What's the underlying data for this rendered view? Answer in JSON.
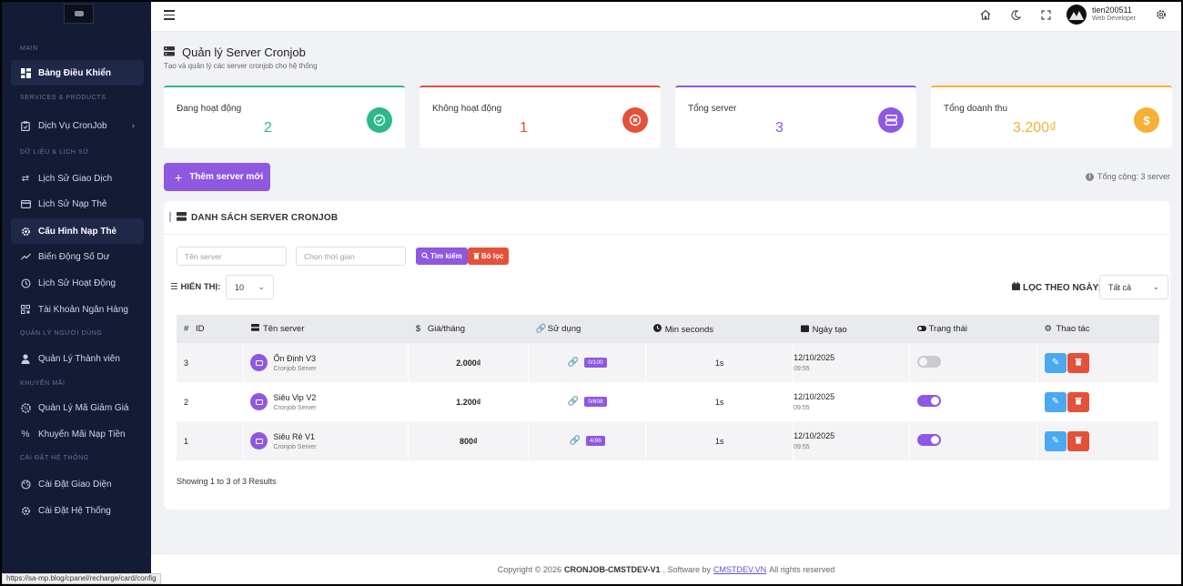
{
  "sidebar": {
    "sections": [
      {
        "label": "MAIN",
        "items": [
          {
            "label": "Bảng Điều Khiển",
            "icon": "dashboard-icon",
            "active": false
          }
        ]
      },
      {
        "label": "SERVICES & PRODUCTS",
        "items": [
          {
            "label": "Dịch Vụ CronJob",
            "icon": "clipboard-icon",
            "has_chevron": true
          }
        ]
      },
      {
        "label": "DỮ LIỆU & LỊCH SỬ",
        "items": [
          {
            "label": "Lịch Sử Giao Dịch",
            "icon": "exchange-icon"
          },
          {
            "label": "Lịch Sử Nạp Thẻ",
            "icon": "card-icon"
          },
          {
            "label": "Cấu Hình Nạp Thẻ",
            "icon": "gear-icon",
            "active": true
          },
          {
            "label": "Biến Động Số Dư",
            "icon": "trend-icon"
          },
          {
            "label": "Lịch Sử Hoạt Động",
            "icon": "history-icon"
          },
          {
            "label": "Tài Khoản Ngân Hàng",
            "icon": "qr-icon"
          }
        ]
      },
      {
        "label": "QUẢN LÝ NGƯỜI DÙNG",
        "items": [
          {
            "label": "Quản Lý Thành viên",
            "icon": "user-icon"
          }
        ]
      },
      {
        "label": "KHUYẾN MÃI",
        "items": [
          {
            "label": "Quản Lý Mã Giảm Giá",
            "icon": "ticket-icon"
          },
          {
            "label": "Khuyến Mãi Nạp Tiền",
            "icon": "percent-icon"
          }
        ]
      },
      {
        "label": "CÀI ĐẶT HỆ THỐNG",
        "items": [
          {
            "label": "Cài Đặt Giao Diện",
            "icon": "palette-icon"
          },
          {
            "label": "Cài Đặt Hệ Thống",
            "icon": "gear-icon"
          }
        ]
      }
    ]
  },
  "topbar": {
    "user_name": "tien200511",
    "user_role": "Web Developer"
  },
  "page": {
    "title": "Quản lý Server Cronjob",
    "subtitle": "Tạo và quản lý các server cronjob cho hệ thống"
  },
  "stats": [
    {
      "label": "Đang hoạt động",
      "value": "2",
      "color": "#2bb98b"
    },
    {
      "label": "Không hoạt động",
      "value": "1",
      "color": "#e4513b"
    },
    {
      "label": "Tổng server",
      "value": "3",
      "color": "#8e58e0"
    },
    {
      "label": "Tổng doanh thu",
      "value": "3.200₫",
      "color": "#f5b035"
    }
  ],
  "actions": {
    "add_server_label": "Thêm server mới",
    "total_label": "Tổng cộng: 3 server"
  },
  "list": {
    "title": "DANH SÁCH SERVER CRONJOB",
    "name_placeholder": "Tên server",
    "time_placeholder": "Chọn thời gian",
    "search_label": "Tìm kiếm",
    "clear_label": "Bỏ lọc",
    "show_label": "HIỂN THỊ:",
    "show_value": "10",
    "filter_label": "LỌC THEO NGÀY:",
    "filter_value": "Tất cả",
    "columns": [
      "ID",
      "Tên server",
      "Giá/tháng",
      "Sử dụng",
      "Min seconds",
      "Ngày tạo",
      "Trạng thái",
      "Thao tác"
    ],
    "rows": [
      {
        "id": "3",
        "name": "Ổn Định V3",
        "sub": "Cronjob Server",
        "price": "2.000₫",
        "usage": "0/100",
        "secs": "1s",
        "date": "12/10/2025",
        "time": "09:55",
        "active": false
      },
      {
        "id": "2",
        "name": "Siêu Vip V2",
        "sub": "Cronjob Server",
        "price": "1.200₫",
        "usage": "0/608",
        "secs": "1s",
        "date": "12/10/2025",
        "time": "09:55",
        "active": true
      },
      {
        "id": "1",
        "name": "Siêu Rẻ V1",
        "sub": "Cronjob Server",
        "price": "800₫",
        "usage": "4/96",
        "secs": "1s",
        "date": "12/10/2025",
        "time": "09:55",
        "active": true
      }
    ],
    "showing": "Showing 1 to 3 of 3 Results"
  },
  "footer": {
    "prefix": "Copyright © 2026",
    "brand": "CRONJOB-CMSTDEV-V1",
    "middle": ". Software by",
    "link": "CMSTDEV.VN",
    "suffix": "All rights reserved"
  },
  "status_url": "https://sa-mp.blog/cpanel/recharge/card/config"
}
